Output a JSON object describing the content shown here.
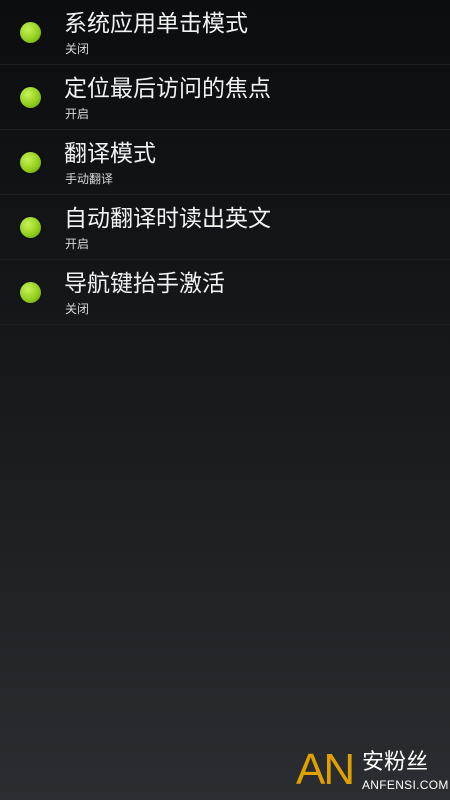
{
  "settings": {
    "items": [
      {
        "title": "系统应用单击模式",
        "summary": "关闭"
      },
      {
        "title": "定位最后访问的焦点",
        "summary": "开启"
      },
      {
        "title": "翻译模式",
        "summary": "手动翻译"
      },
      {
        "title": "自动翻译时读出英文",
        "summary": "开启"
      },
      {
        "title": "导航键抬手激活",
        "summary": "关闭"
      }
    ],
    "indicator_color": "#8cc63f"
  },
  "watermark": {
    "letters": "AN",
    "chinese": "安粉丝",
    "domain": "ANFENSI.COM",
    "color": "#e0a000"
  }
}
